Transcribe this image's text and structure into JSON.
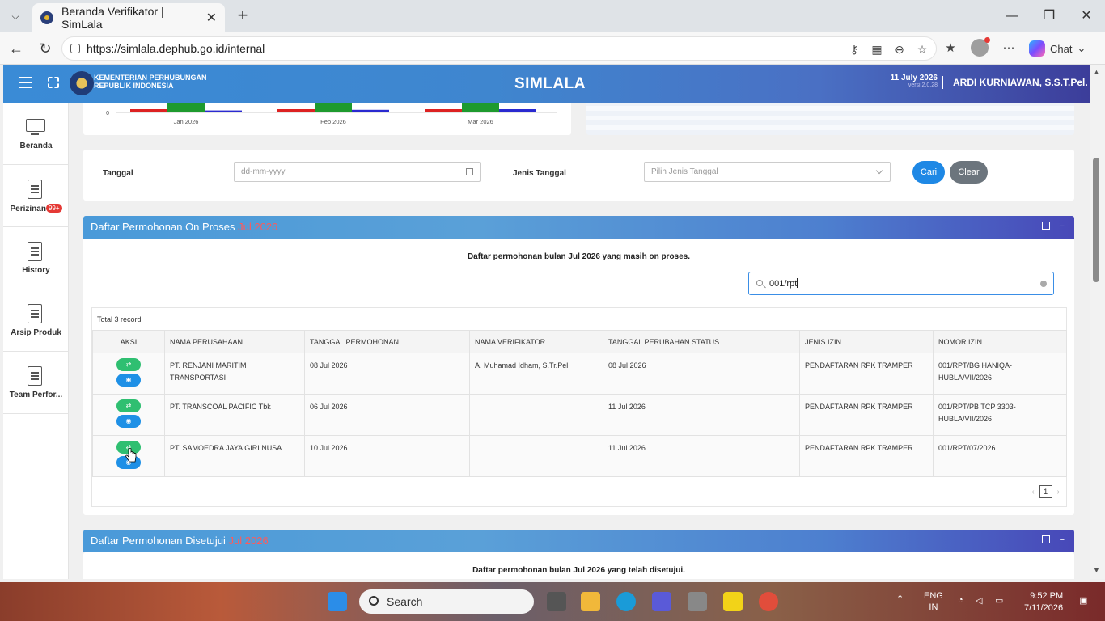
{
  "browser": {
    "tab_title": "Beranda Verifikator | SimLala",
    "url": "https://simlala.dephub.go.id/internal",
    "chat_label": "Chat"
  },
  "header": {
    "ministry_line1": "KEMENTERIAN PERHUBUNGAN",
    "ministry_line2": "REPUBLIK INDONESIA",
    "app_title": "SIMLALA",
    "date": "11 July 2026",
    "version": "versi 2.0.28",
    "user": "ARDI KURNIAWAN, S.S.T.Pel."
  },
  "sidebar": {
    "items": [
      {
        "label": "Beranda"
      },
      {
        "label": "Perizinan",
        "badge": "99+"
      },
      {
        "label": "History"
      },
      {
        "label": "Arsip Produk"
      },
      {
        "label": "Team Perfor..."
      }
    ]
  },
  "chart": {
    "y_zero": "0",
    "months": [
      "Jan 2026",
      "Feb 2026",
      "Mar 2026"
    ]
  },
  "chart_data": {
    "type": "bar",
    "categories": [
      "Jan 2026",
      "Feb 2026",
      "Mar 2026"
    ],
    "series": [
      {
        "values": [
          1,
          1,
          1
        ],
        "color": "#dd2222"
      },
      {
        "values": [
          3,
          3,
          3
        ],
        "color": "#1e9a2e"
      },
      {
        "values": [
          0.6,
          0.8,
          1
        ],
        "color": "#2a2ad0"
      }
    ],
    "ylim_visible": [
      0,
      3
    ]
  },
  "filter": {
    "tanggal_label": "Tanggal",
    "tanggal_placeholder": "dd-mm-yyyy",
    "jenis_label": "Jenis Tanggal",
    "jenis_placeholder": "Pilih Jenis Tanggal",
    "cari": "Cari",
    "clear": "Clear"
  },
  "onproses": {
    "title": "Daftar Permohonan On Proses",
    "month": "Jul 2026",
    "subtitle": "Daftar permohonan bulan Jul 2026 yang masih on proses.",
    "search_value": "001/rpt",
    "total": "Total 3 record",
    "columns": [
      "AKSI",
      "NAMA PERUSAHAAN",
      "TANGGAL PERMOHONAN",
      "NAMA VERIFIKATOR",
      "TANGGAL PERUBAHAN STATUS",
      "JENIS IZIN",
      "NOMOR IZIN"
    ],
    "rows": [
      {
        "perusahaan": "PT. RENJANI MARITIM TRANSPORTASI",
        "tgl_permohonan": "08 Jul 2026",
        "verifikator": "A. Muhamad Idham, S.Tr.Pel",
        "tgl_status": "08 Jul 2026",
        "jenis": "PENDAFTARAN RPK TRAMPER",
        "nomor": "001/RPT/BG HANIQA-HUBLA/VII/2026"
      },
      {
        "perusahaan": "PT. TRANSCOAL PACIFIC Tbk",
        "tgl_permohonan": "06 Jul 2026",
        "verifikator": "",
        "tgl_status": "11 Jul 2026",
        "jenis": "PENDAFTARAN RPK TRAMPER",
        "nomor": "001/RPT/PB TCP 3303-HUBLA/VII/2026"
      },
      {
        "perusahaan": "PT. SAMOEDRA JAYA GIRI NUSA",
        "tgl_permohonan": "10 Jul 2026",
        "verifikator": "",
        "tgl_status": "11 Jul 2026",
        "jenis": "PENDAFTARAN RPK TRAMPER",
        "nomor": "001/RPT/07/2026"
      }
    ],
    "page": "1"
  },
  "disetujui": {
    "title": "Daftar Permohonan Disetujui",
    "month": "Jul 2026",
    "subtitle": "Daftar permohonan bulan Jul 2026 yang telah disetujui."
  },
  "taskbar": {
    "search": "Search",
    "lang1": "ENG",
    "lang2": "IN",
    "time": "9:52 PM",
    "date": "7/11/2026"
  }
}
